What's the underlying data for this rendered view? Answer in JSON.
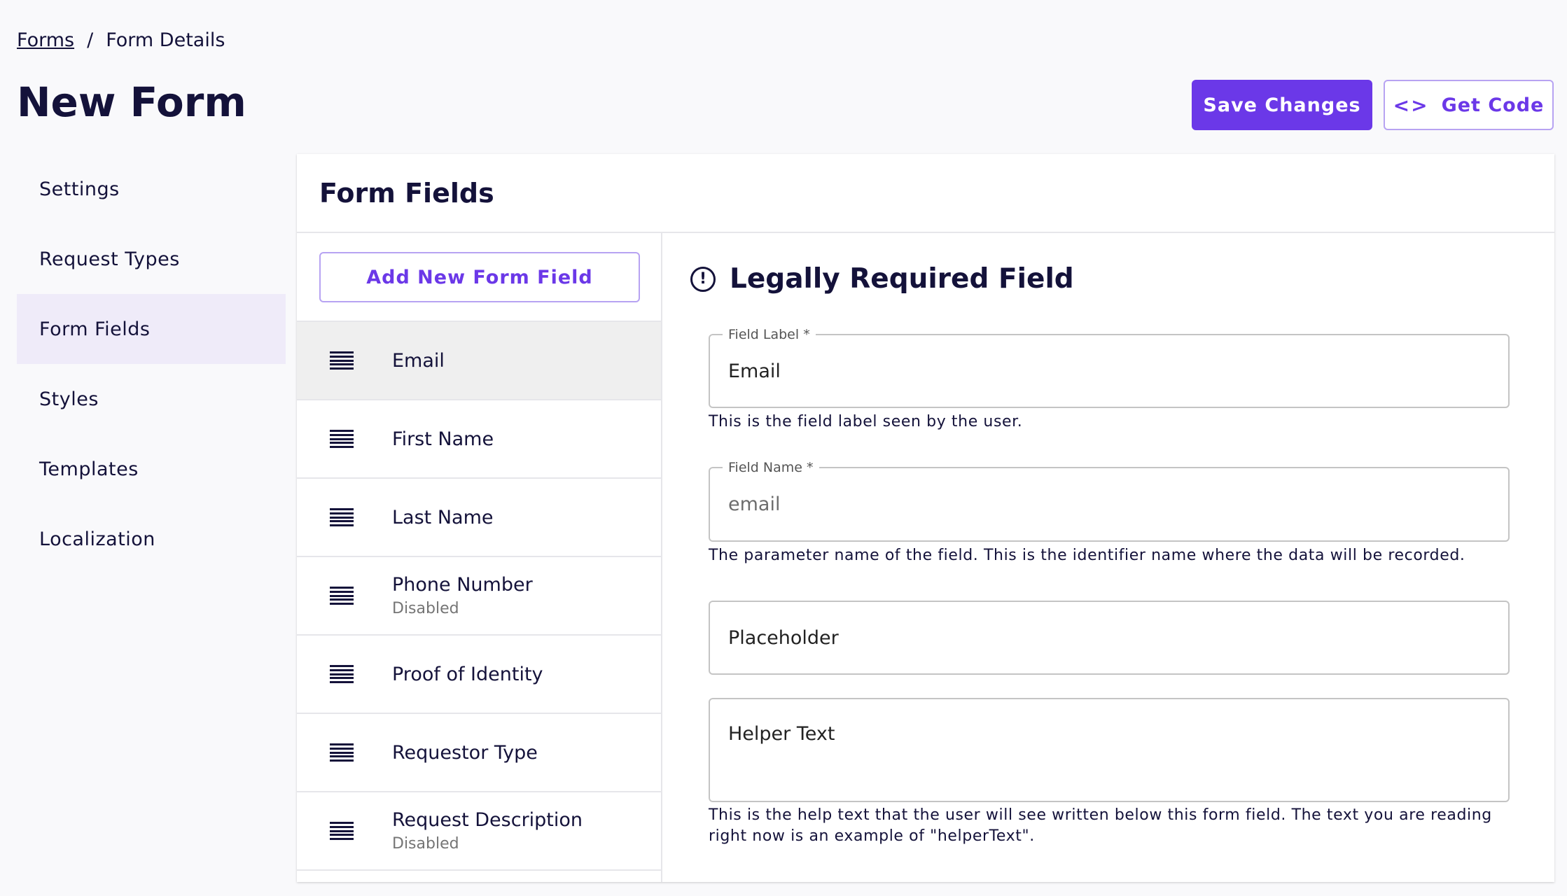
{
  "breadcrumb": {
    "root": "Forms",
    "separator": "/",
    "current": "Form Details"
  },
  "page": {
    "title": "New Form"
  },
  "actions": {
    "save_label": "Save Changes",
    "get_code_label": "Get Code",
    "get_code_icon": "code-icon"
  },
  "colors": {
    "accent": "#6b38e8",
    "nav_active_bg": "#efebf9",
    "text": "#14123a"
  },
  "sidenav": {
    "items": [
      {
        "label": "Settings",
        "active": false
      },
      {
        "label": "Request Types",
        "active": false
      },
      {
        "label": "Form Fields",
        "active": true
      },
      {
        "label": "Styles",
        "active": false
      },
      {
        "label": "Templates",
        "active": false
      },
      {
        "label": "Localization",
        "active": false
      }
    ]
  },
  "card": {
    "title": "Form Fields",
    "add_button_label": "Add New Form Field"
  },
  "fields": [
    {
      "label": "Email",
      "sub": "",
      "selected": true
    },
    {
      "label": "First Name",
      "sub": ""
    },
    {
      "label": "Last Name",
      "sub": ""
    },
    {
      "label": "Phone Number",
      "sub": "Disabled"
    },
    {
      "label": "Proof of Identity",
      "sub": ""
    },
    {
      "label": "Requestor Type",
      "sub": ""
    },
    {
      "label": "Request Description",
      "sub": "Disabled"
    }
  ],
  "detail": {
    "title": "Legally Required Field",
    "field_label": {
      "legend": "Field Label *",
      "value": "Email",
      "helper": "This is the field label seen by the user."
    },
    "field_name": {
      "legend": "Field Name *",
      "value": "email",
      "helper": "The parameter name of the field. This is the identifier name where the data will be recorded."
    },
    "placeholder": {
      "placeholder": "Placeholder"
    },
    "helper_text": {
      "placeholder": "Helper Text",
      "helper": "This is the help text that the user will see written below this form field. The text you are reading right now is an example of \"helperText\"."
    }
  }
}
